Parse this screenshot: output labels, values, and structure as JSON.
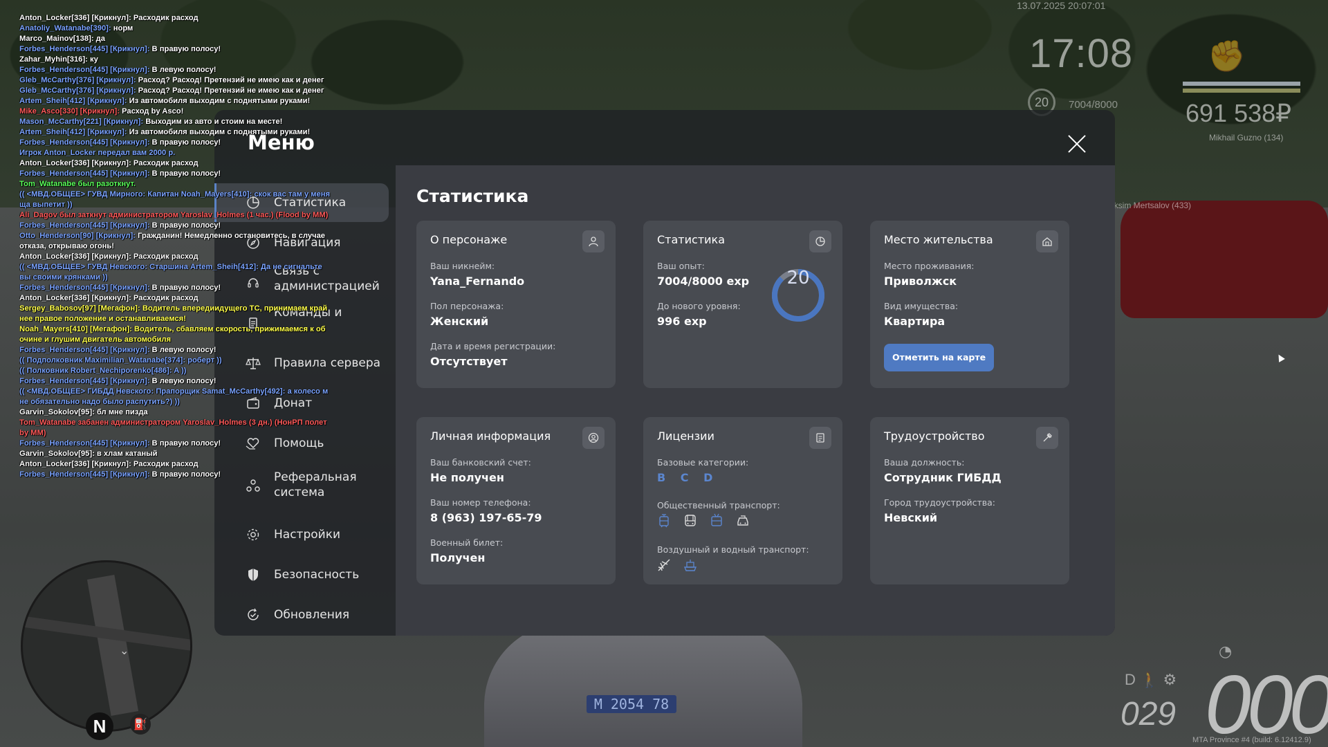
{
  "hud": {
    "date": "13.07.2025 20:07:01",
    "time": "17:08",
    "level": "20",
    "exp": "7004/8000",
    "money": "691 538₽",
    "player": "Mikhail Guzno (134)",
    "player2": "aksim Mertsalov (433)",
    "fuel": "029",
    "speed": "000",
    "gear": "D",
    "compass": "N",
    "plate": "M 2054 78",
    "build": "MTA Province #4 (build: 6.12412.9)"
  },
  "chat": [
    {
      "name": "Anton_Locker[336] [Крикнул]:",
      "text": " Расходик расход",
      "color": "#ffffff"
    },
    {
      "name": "Anatoliy_Watanabe[390]:",
      "text": " норм",
      "color": "#7aa3ff"
    },
    {
      "name": "Marco_Mainov[138]:",
      "text": " да",
      "color": "#ffffff"
    },
    {
      "name": "Forbes_Henderson[445] [Крикнул]:",
      "text": " В правую полосу!",
      "color": "#7aa3ff"
    },
    {
      "name": "Zahar_Myhin[316]:",
      "text": " ку",
      "color": "#ffffff"
    },
    {
      "name": "Forbes_Henderson[445] [Крикнул]:",
      "text": " В левую полосу!",
      "color": "#7aa3ff"
    },
    {
      "name": "Gleb_McCarthy[376] [Крикнул]:",
      "text": " Расход? Расход! Претензий не имею как и денег",
      "color": "#7aa3ff"
    },
    {
      "name": "Gleb_McCarthy[376] [Крикнул]:",
      "text": " Расход? Расход! Претензий не имею как и денег",
      "color": "#7aa3ff"
    },
    {
      "name": "Artem_Sheih[412] [Крикнул]:",
      "text": " Из автомобиля выходим с поднятыми руками!",
      "color": "#7aa3ff"
    },
    {
      "name": "Mike_Asco[330] [Крикнул]:",
      "text": " Расход by Asco!",
      "color": "#ff5a5a"
    },
    {
      "name": "Mason_McCarthy[221] [Крикнул]:",
      "text": " Выходим из авто и стоим на месте!",
      "color": "#7aa3ff"
    },
    {
      "name": "Artem_Sheih[412] [Крикнул]:",
      "text": " Из автомобиля выходим с поднятыми руками!",
      "color": "#7aa3ff"
    },
    {
      "name": "Forbes_Henderson[445] [Крикнул]:",
      "text": " В правую полосу!",
      "color": "#7aa3ff"
    },
    {
      "name": "Игрок Anton_Locker передал вам 2000 р.",
      "text": "",
      "color": "#7aa3ff"
    },
    {
      "name": "Anton_Locker[336] [Крикнул]:",
      "text": " Расходик расход",
      "color": "#ffffff"
    },
    {
      "name": "Forbes_Henderson[445] [Крикнул]:",
      "text": " В правую полосу!",
      "color": "#7aa3ff"
    },
    {
      "name": "Tom_Watanabe был разоткнут.",
      "text": "",
      "color": "#5aff5a"
    },
    {
      "name": "(( <МВД.ОБЩЕЕ> ГУВД Мирного: Капитан Noah_Mayers[410]: скок вас там у меня",
      "text": "",
      "color": "#7aa3ff"
    },
    {
      "name": " ща выпетит ))",
      "text": "",
      "color": "#7aa3ff"
    },
    {
      "name": "Ali_Dagov был заткнут администратором Yaroslav_Holmes (1 час.) (Flood by MM)",
      "text": "",
      "color": "#ff5a5a"
    },
    {
      "name": "Forbes_Henderson[445] [Крикнул]:",
      "text": " В правую полосу!",
      "color": "#7aa3ff"
    },
    {
      "name": "Otto_Henderson[90] [Крикнул]:",
      "text": " Гражданин! Немедленно остановитесь, в случае",
      "color": "#7aa3ff"
    },
    {
      "name": "отказа, открываю огонь!",
      "text": "",
      "color": "#ffffff"
    },
    {
      "name": "Anton_Locker[336] [Крикнул]:",
      "text": " Расходик расход",
      "color": "#ffffff"
    },
    {
      "name": "(( <МВД.ОБЩЕЕ> ГУВД Невского: Старшина Artem_Sheih[412]: Да не сигнальте",
      "text": "",
      "color": "#7aa3ff"
    },
    {
      "name": " вы своими крянками ))",
      "text": "",
      "color": "#7aa3ff"
    },
    {
      "name": "Forbes_Henderson[445] [Крикнул]:",
      "text": " В правую полосу!",
      "color": "#7aa3ff"
    },
    {
      "name": "Anton_Locker[336] [Крикнул]:",
      "text": " Расходик расход",
      "color": "#ffffff"
    },
    {
      "name": "Sergey_Babosov[97] [Мегафон]:",
      "text": " Водитель впередиидущего ТС, принимаем край",
      "color": "#ffff4a"
    },
    {
      "name": "нее правое положение и останавливаемся!",
      "text": "",
      "color": "#ffff4a"
    },
    {
      "name": "Noah_Mayers[410] [Мегафон]:",
      "text": " Водитель, сбавляем скорость, прижимаемся к об",
      "color": "#ffff4a"
    },
    {
      "name": "очине и глушим двигатель автомобиля",
      "text": "",
      "color": "#ffff4a"
    },
    {
      "name": "Forbes_Henderson[445] [Крикнул]:",
      "text": " В левую полосу!",
      "color": "#7aa3ff"
    },
    {
      "name": "(( Подполковник Maximilian_Watanabe[374]: роберт ))",
      "text": "",
      "color": "#7aa3ff"
    },
    {
      "name": "(( Полковник Robert_Nechiporenko[486]: A ))",
      "text": "",
      "color": "#7aa3ff"
    },
    {
      "name": "Forbes_Henderson[445] [Крикнул]:",
      "text": " В левую полосу!",
      "color": "#7aa3ff"
    },
    {
      "name": "(( <МВД.ОБЩЕЕ> ГИБДД Невского: Прапорщик Samat_McCarthy[492]: а колесо м",
      "text": "",
      "color": "#7aa3ff"
    },
    {
      "name": "не обязательно надо было распутить?) ))",
      "text": "",
      "color": "#7aa3ff"
    },
    {
      "name": "Garvin_Sokolov[95]:",
      "text": " бл мне пизда",
      "color": "#ffffff"
    },
    {
      "name": "Tom_Watanabe забанен администратором Yaroslav_Holmes (3 дн.) (НонРП полет",
      "text": "",
      "color": "#ff5a5a"
    },
    {
      "name": " by MM)",
      "text": "",
      "color": "#ff5a5a"
    },
    {
      "name": "Forbes_Henderson[445] [Крикнул]:",
      "text": " В правую полосу!",
      "color": "#7aa3ff"
    },
    {
      "name": "Garvin_Sokolov[95]:",
      "text": " в хлам катаный",
      "color": "#ffffff"
    },
    {
      "name": "Anton_Locker[336] [Крикнул]:",
      "text": " Расходик расход",
      "color": "#ffffff"
    },
    {
      "name": "Forbes_Henderson[445] [Крикнул]:",
      "text": " В правую полосу!",
      "color": "#7aa3ff"
    }
  ],
  "menu": {
    "title": "Меню",
    "nav": [
      {
        "label": "Статистика"
      },
      {
        "label": "Навигация"
      },
      {
        "label": "Связь с администрацией"
      },
      {
        "label": "Команды и"
      },
      {
        "label": "Правила сервера"
      },
      {
        "label": "Донат"
      },
      {
        "label": "Помощь"
      },
      {
        "label": "Реферальная система"
      },
      {
        "label": "Настройки"
      },
      {
        "label": "Безопасность"
      },
      {
        "label": "Обновления"
      }
    ]
  },
  "stats": {
    "title": "Статистика",
    "character": {
      "title": "О персонаже",
      "nick_label": "Ваш никнейм:",
      "nick": "Yana_Fernando",
      "gender_label": "Пол персонажа:",
      "gender": "Женский",
      "reg_label": "Дата и время регистрации:",
      "reg": "Отсутствует"
    },
    "experience": {
      "title": "Статистика",
      "exp_label": "Ваш опыт:",
      "exp": "7004/8000 exp",
      "next_label": "До нового уровня:",
      "next": "996 exp",
      "level": "20",
      "progress": 0.8755
    },
    "residence": {
      "title": "Место жительства",
      "place_label": "Место проживания:",
      "place": "Приволжск",
      "property_label": "Вид имущества:",
      "property": "Квартира",
      "map_button": "Отметить на карте"
    },
    "personal": {
      "title": "Личная информация",
      "bank_label": "Ваш банковский счет:",
      "bank": "Не получен",
      "phone_label": "Ваш номер телефона:",
      "phone": "8 (963) 197-65-79",
      "military_label": "Военный билет:",
      "military": "Получен"
    },
    "licenses": {
      "title": "Лицензии",
      "base_label": "Базовые категории:",
      "base": "B C D",
      "public_label": "Общественный транспорт:",
      "air_label": "Воздушный и водный транспорт:"
    },
    "job": {
      "title": "Трудоустройство",
      "position_label": "Ваша должность:",
      "position": "Сотрудник ГИБДД",
      "city_label": "Город трудоустройства:",
      "city": "Невский"
    }
  },
  "colors": {
    "accent": "#4f7ac2",
    "panel": "#3a3c42",
    "card": "#484b51",
    "ring_track": "#7a7f8a",
    "ring_fill": "#4a76c0"
  }
}
